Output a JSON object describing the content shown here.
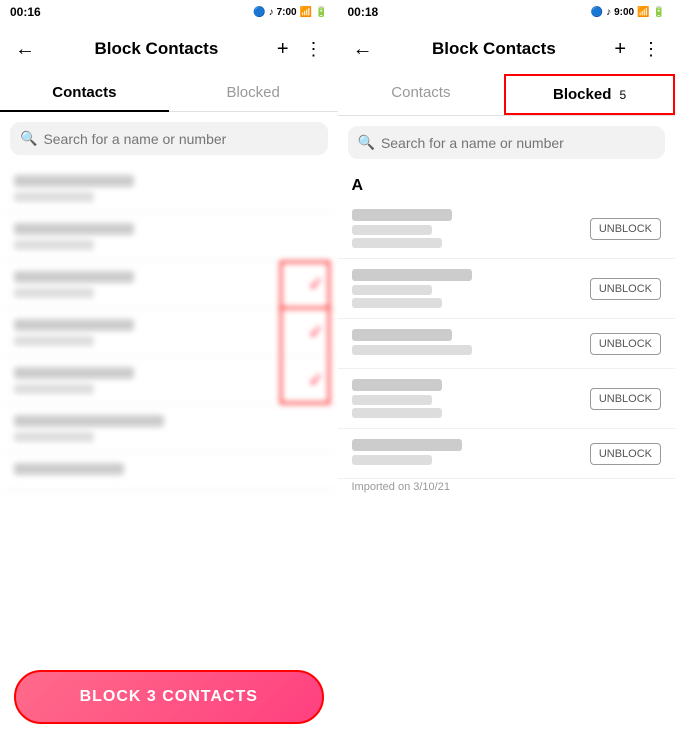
{
  "left_panel": {
    "status_bar": {
      "time": "00:16",
      "icons": "🔵 🎵 7:00 KB/s ↑↓ 📶 🔋"
    },
    "header": {
      "title": "Block Contacts",
      "back_label": "←",
      "add_icon": "+",
      "more_icon": "⋮"
    },
    "tabs": [
      {
        "label": "Contacts",
        "active": true,
        "badge": null
      },
      {
        "label": "Blocked",
        "active": false,
        "badge": null
      }
    ],
    "search": {
      "placeholder": "Search for a name or number"
    },
    "contacts": [
      {
        "name": "Contact 1",
        "detail": "12345678",
        "checked": false
      },
      {
        "name": "AC Service G7",
        "detail": "987654321",
        "checked": false
      },
      {
        "name": "Account Info",
        "detail": "111222333",
        "checked": true
      },
      {
        "name": "ACi Adriel",
        "detail": "444555666",
        "checked": true
      },
      {
        "name": "ACi Ahmed Dan",
        "detail": "777888999",
        "checked": true
      },
      {
        "name": "ACi Asuntom Wild LIRN",
        "detail": "000111222",
        "checked": false
      }
    ],
    "block_button": {
      "label": "BLOCK 3 CONTACTS"
    }
  },
  "right_panel": {
    "status_bar": {
      "time": "00:18",
      "icons": "🔵 🎵 9:00 KB/s ↑↓ 📶 🔋"
    },
    "header": {
      "title": "Block Contacts",
      "back_label": "←",
      "add_icon": "+",
      "more_icon": "⋮"
    },
    "tabs": [
      {
        "label": "Contacts",
        "active": false,
        "badge": null
      },
      {
        "label": "Blocked",
        "active": true,
        "badge": "5",
        "highlighted": true
      }
    ],
    "search": {
      "placeholder": "Search for a name or number"
    },
    "section_a": "A",
    "blocked_contacts": [
      {
        "name": "Adamluis",
        "detail1": "9876543210",
        "detail2": "Some address 9082",
        "imported": null
      },
      {
        "name": "Adivert Rajkoshi",
        "detail1": "1234567890",
        "detail2": "Some address 8082",
        "imported": null
      },
      {
        "name": "Account Info",
        "detail1": "Some address 0101",
        "detail2": null,
        "imported": null
      },
      {
        "name": "ACi Adriel",
        "detail1": "4445556667",
        "detail2": "Some address 8082",
        "imported": null
      },
      {
        "name": "ACi Ahmed Dan",
        "detail1": "7778889990",
        "detail2": null,
        "imported": "Imported on 3/10/21"
      }
    ],
    "unblock_label": "UNBLOCK"
  }
}
